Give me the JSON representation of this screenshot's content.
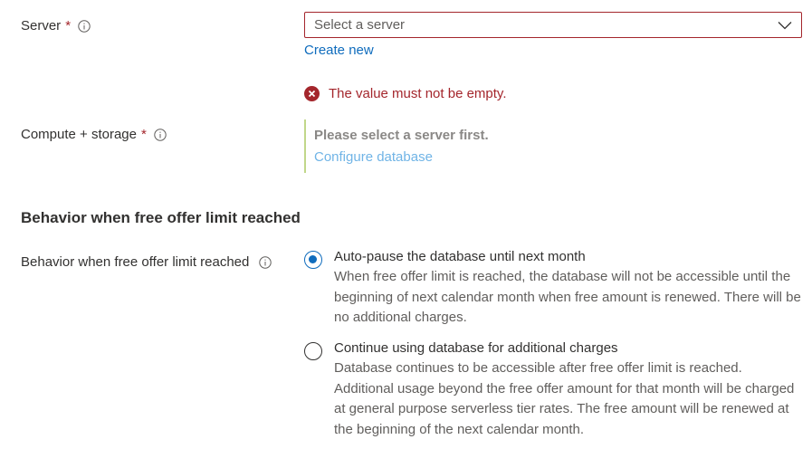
{
  "server": {
    "label": "Server",
    "required_mark": "*",
    "select_placeholder": "Select a server",
    "create_new": "Create new",
    "error": "The value must not be empty."
  },
  "compute": {
    "label": "Compute + storage",
    "required_mark": "*",
    "message": "Please select a server first.",
    "configure_link": "Configure database"
  },
  "behavior": {
    "section_title": "Behavior when free offer limit reached",
    "label": "Behavior when free offer limit reached",
    "options": [
      {
        "title": "Auto-pause the database until next month",
        "description": "When free offer limit is reached, the database will not be accessible until the beginning of next calendar month when free amount is renewed. There will be no additional charges.",
        "checked": true
      },
      {
        "title": "Continue using database for additional charges",
        "description": "Database continues to be accessible after free offer limit is reached. Additional usage beyond the free offer amount for that month will be charged at general purpose serverless tier rates. The free amount will be renewed at the beginning of the next calendar month.",
        "checked": false
      }
    ]
  },
  "colors": {
    "error": "#a4262c",
    "link": "#0f6cbd",
    "disabled_link": "#70b4e6",
    "info_border": "#c1d78a"
  }
}
